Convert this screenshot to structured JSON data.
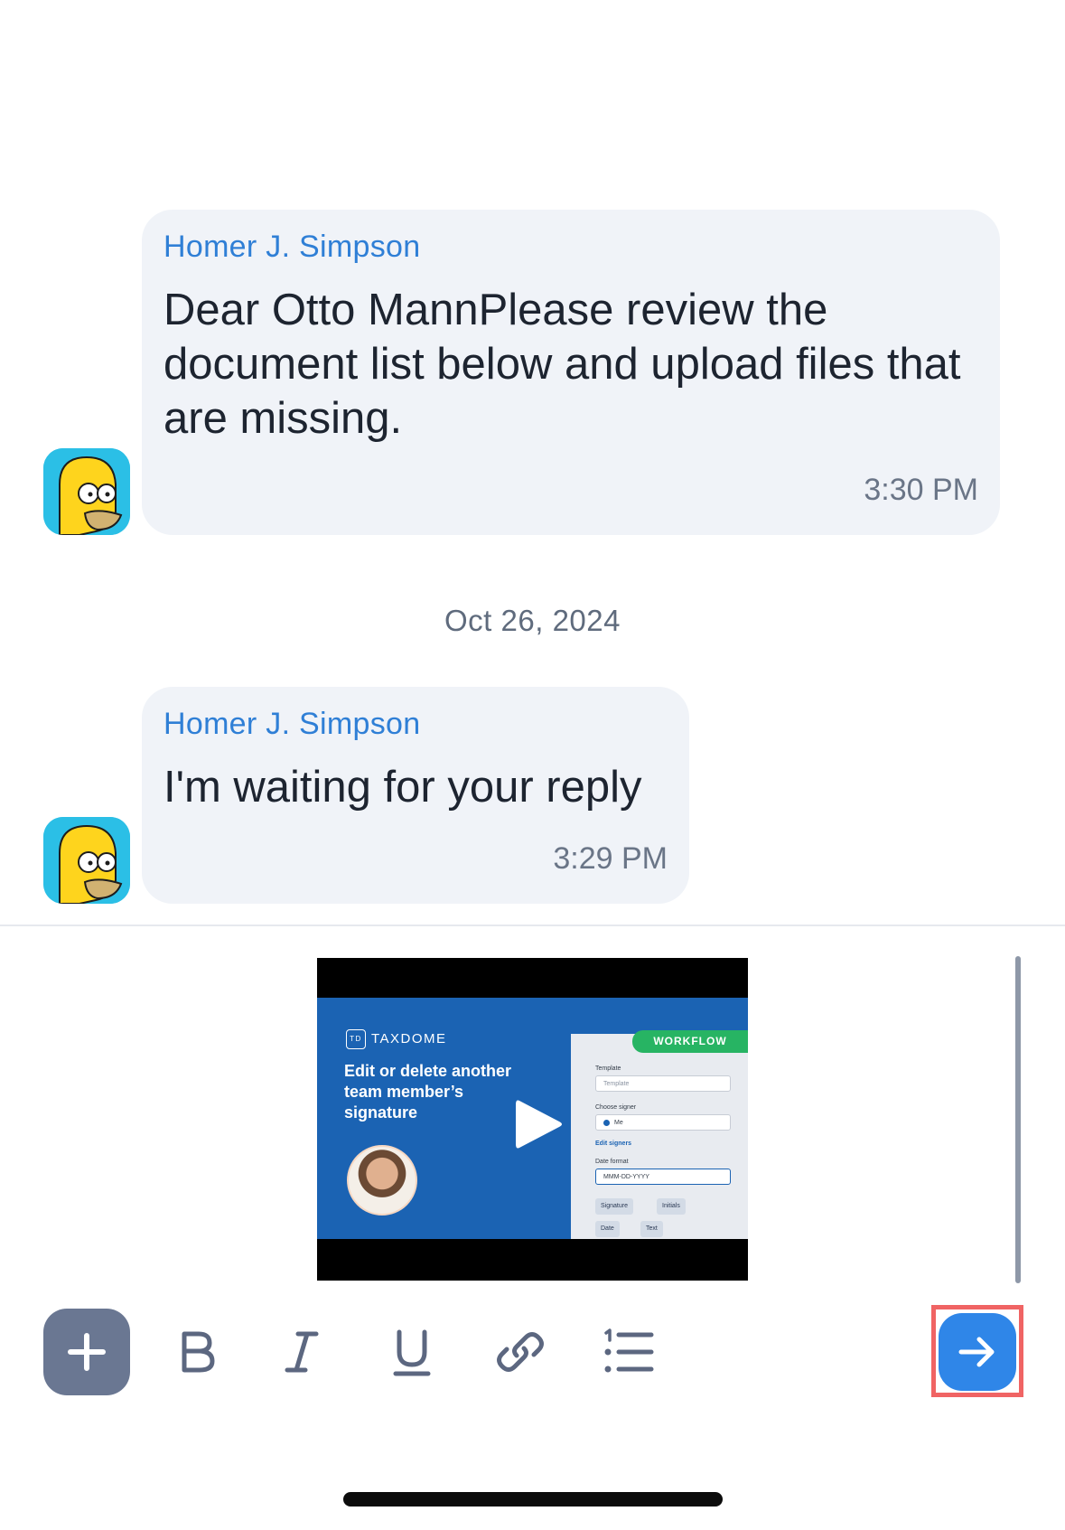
{
  "messages": [
    {
      "sender": "Homer J. Simpson",
      "text": "Dear Otto MannPlease review the document list below and upload files that are missing.",
      "time": "3:30 PM",
      "avatar": "homer-avatar"
    },
    {
      "sender": "Homer J. Simpson",
      "text": "I'm waiting for your reply",
      "time": "3:29 PM",
      "avatar": "homer-avatar"
    }
  ],
  "date_separator": "Oct 26, 2024",
  "video": {
    "brand": "TAXDOME",
    "brand_badge": "TD",
    "title": "Edit or delete another team member’s signature",
    "tag": "WORKFLOW",
    "panel": {
      "template_label": "Template",
      "template_placeholder": "Template",
      "signer_label": "Choose signer",
      "signer_value": "Me",
      "edit_signers": "Edit signers",
      "date_format_label": "Date format",
      "date_format_value": "MMM-DD-YYYY",
      "chips": [
        "Signature",
        "Initials",
        "Date",
        "Text"
      ]
    }
  },
  "toolbar": {
    "add": "plus-icon",
    "bold": "bold-icon",
    "italic": "italic-icon",
    "underline": "underline-icon",
    "link": "link-icon",
    "list": "numbered-list-icon",
    "send": "arrow-right-icon"
  },
  "colors": {
    "accent": "#2f86e8",
    "sender": "#2f7fd6",
    "bubble": "#f0f3f8",
    "highlight": "#f06464"
  }
}
